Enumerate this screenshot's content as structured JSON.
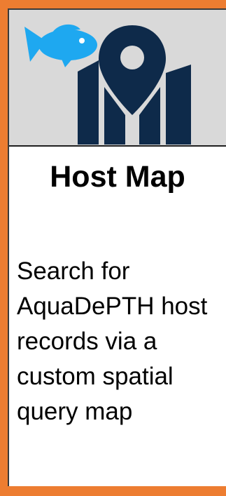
{
  "card": {
    "title": "Host Map",
    "description": "Search for AquaDePTH host records via a custom spatial query map"
  },
  "icons": {
    "fish": "fish-icon",
    "map_pin": "map-pin-icon"
  },
  "colors": {
    "accent_border": "#ED7D31",
    "fish": "#1EA8F0",
    "map": "#0E2A4A",
    "panel": "#D9D9D9"
  }
}
